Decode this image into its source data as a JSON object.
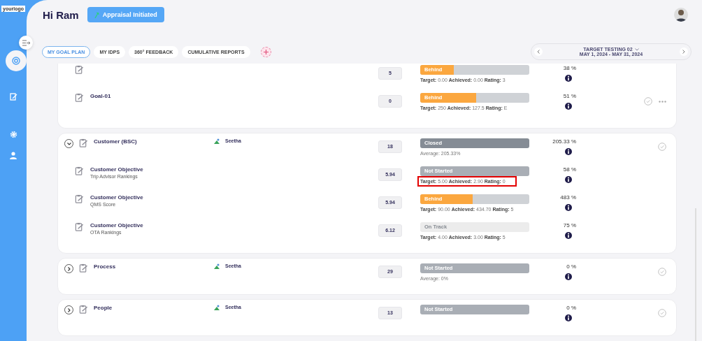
{
  "logo": "yourlogo",
  "header": {
    "greeting": "Hi Ram",
    "status_button": "Appraisal Initiated"
  },
  "tabs": [
    {
      "label": "MY GOAL PLAN",
      "selected": true
    },
    {
      "label": "MY IDPS",
      "selected": false
    },
    {
      "label": "360° FEEDBACK",
      "selected": false
    },
    {
      "label": "CUMULATIVE REPORTS",
      "selected": false
    }
  ],
  "period": {
    "title": "TARGET TESTING 02",
    "dates": "MAY 1, 2024 - MAY 31, 2024"
  },
  "sidebar": {
    "items": [
      {
        "kind": "goals",
        "selected": true
      },
      {
        "kind": "review",
        "selected": false
      },
      {
        "kind": "settings",
        "selected": false
      },
      {
        "kind": "profile",
        "selected": false
      }
    ]
  },
  "groups": [
    {
      "rows": [
        {
          "weight": "5",
          "status": {
            "kind": "behind",
            "label": "Behind",
            "level": 0.31
          },
          "detail": "**Target:** 0.00 **Achieved:** 0.00 **Rating:** 3",
          "percent": "38 %",
          "actions": false
        },
        {
          "title": "Goal-01",
          "weight": "0",
          "status": {
            "kind": "behind",
            "label": "Behind",
            "level": 0.51
          },
          "detail": "**Target:** 250 **Achieved:** 127.5 **Rating:** E",
          "percent": "51 %",
          "actions": true
        }
      ]
    },
    {
      "title": "Customer (BSC)",
      "expanded": true,
      "owner": "Seetha",
      "weight": "18",
      "status": {
        "kind": "closed",
        "label": "Closed"
      },
      "detail": "Average: 205.33%",
      "percent": "205.33 %",
      "rows": [
        {
          "title": "Customer Objective",
          "subtitle": "Trip Advisor Rankings",
          "weight": "5.94",
          "status": {
            "kind": "not_started",
            "label": "Not Started"
          },
          "detail": "**Target:** 5.00 **Achieved:** 2.90 **Rating:** 0",
          "highlighted": true,
          "percent": "58 %",
          "actions": false
        },
        {
          "title": "Customer Objective",
          "subtitle": "QMS Score",
          "weight": "5.94",
          "status": {
            "kind": "behind",
            "label": "Behind",
            "level": 0.48
          },
          "detail": "**Target:** 90.00 **Achieved:** 434.70 **Rating:** 5",
          "percent": "483 %",
          "actions": false
        },
        {
          "title": "Customer Objective",
          "subtitle": "OTA Rankings",
          "weight": "6.12",
          "status": {
            "kind": "on_track",
            "label": "On Track"
          },
          "detail": "**Target:** 4.00 **Achieved:** 3.00 **Rating:** 5",
          "percent": "75 %",
          "actions": false
        }
      ]
    },
    {
      "title": "Process",
      "expanded": false,
      "owner": "Seetha",
      "weight": "29",
      "status": {
        "kind": "not_started",
        "label": "Not Started"
      },
      "detail": "Average: 0%",
      "percent": "0 %"
    },
    {
      "title": "People",
      "expanded": false,
      "owner": "Seetha",
      "weight": "13",
      "status": {
        "kind": "not_started",
        "label": "Not Started"
      },
      "percent": "0 %"
    }
  ]
}
